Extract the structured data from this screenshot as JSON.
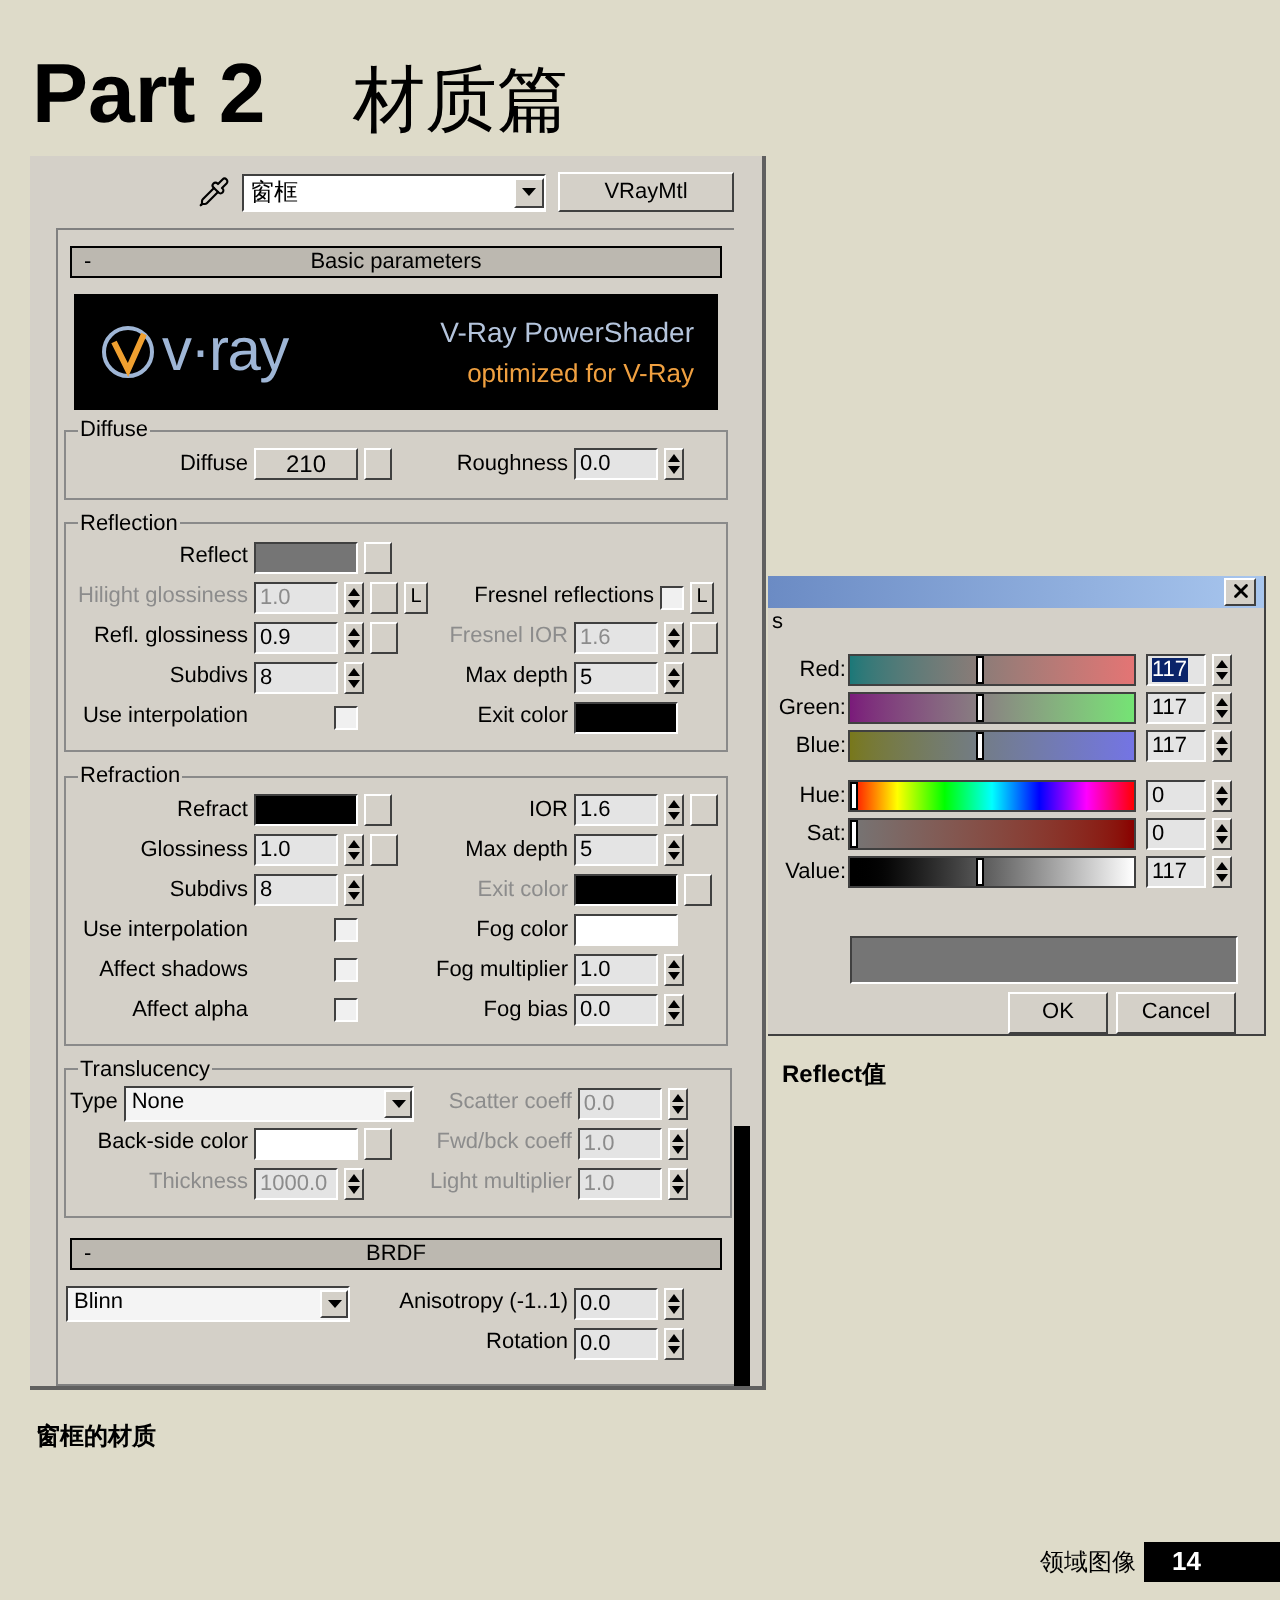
{
  "heading": {
    "part": "Part 2",
    "title": "材质篇"
  },
  "material_editor": {
    "material_name": "窗框",
    "type_button": "VRayMtl",
    "rollouts": [
      {
        "toggle": "-",
        "title": "Basic parameters",
        "banner": {
          "logo": "v·ray",
          "title": "V-Ray PowerShader",
          "subtitle": "optimized for V-Ray"
        },
        "groups": [
          {
            "title": "Diffuse",
            "rows": [
              {
                "left": {
                  "kind": "color",
                  "label": "Diffuse",
                  "color": "#d4d0c8",
                  "swatch_text": "210",
                  "map": true
                },
                "right": {
                  "kind": "spinner",
                  "label": "Roughness",
                  "value": "0.0",
                  "disabled": false
                }
              }
            ]
          },
          {
            "title": "Reflection",
            "rows": [
              {
                "left": {
                  "kind": "color",
                  "label": "Reflect",
                  "color": "#757575",
                  "map": true
                }
              },
              {
                "left": {
                  "kind": "spinner",
                  "label": "Hilight glossiness",
                  "value": "1.0",
                  "disabled": true,
                  "map": true,
                  "lock": "L"
                },
                "right": {
                  "kind": "checkbox",
                  "label": "Fresnel reflections",
                  "checked": false,
                  "lock": "L"
                }
              },
              {
                "left": {
                  "kind": "spinner",
                  "label": "Refl. glossiness",
                  "value": "0.9",
                  "disabled": false,
                  "map": true
                },
                "right": {
                  "kind": "spinner",
                  "label": "Fresnel IOR",
                  "value": "1.6",
                  "disabled": true,
                  "map": true
                }
              },
              {
                "left": {
                  "kind": "spinner",
                  "label": "Subdivs",
                  "value": "8",
                  "disabled": false
                },
                "right": {
                  "kind": "spinner",
                  "label": "Max depth",
                  "value": "5",
                  "disabled": false
                }
              },
              {
                "left": {
                  "kind": "checkbox",
                  "label": "Use interpolation",
                  "checked": false
                },
                "right": {
                  "kind": "color",
                  "label": "Exit color",
                  "color": "#000000"
                }
              }
            ]
          },
          {
            "title": "Refraction",
            "rows": [
              {
                "left": {
                  "kind": "color",
                  "label": "Refract",
                  "color": "#000000",
                  "map": true
                },
                "right": {
                  "kind": "spinner",
                  "label": "IOR",
                  "value": "1.6",
                  "disabled": false,
                  "map": true
                }
              },
              {
                "left": {
                  "kind": "spinner",
                  "label": "Glossiness",
                  "value": "1.0",
                  "disabled": false,
                  "map": true
                },
                "right": {
                  "kind": "spinner",
                  "label": "Max depth",
                  "value": "5",
                  "disabled": false
                }
              },
              {
                "left": {
                  "kind": "spinner",
                  "label": "Subdivs",
                  "value": "8",
                  "disabled": false
                },
                "right": {
                  "kind": "color",
                  "label": "Exit color",
                  "color": "#000000",
                  "disabled": true,
                  "map": true
                }
              },
              {
                "left": {
                  "kind": "checkbox",
                  "label": "Use interpolation",
                  "checked": false
                },
                "right": {
                  "kind": "color",
                  "label": "Fog color",
                  "color": "#ffffff"
                }
              },
              {
                "left": {
                  "kind": "checkbox",
                  "label": "Affect shadows",
                  "checked": false
                },
                "right": {
                  "kind": "spinner",
                  "label": "Fog multiplier",
                  "value": "1.0",
                  "disabled": false
                }
              },
              {
                "left": {
                  "kind": "checkbox",
                  "label": "Affect alpha",
                  "checked": false
                },
                "right": {
                  "kind": "spinner",
                  "label": "Fog bias",
                  "value": "0.0",
                  "disabled": false
                }
              }
            ]
          },
          {
            "title": "Translucency",
            "rows": [
              {
                "left": {
                  "kind": "dropdown",
                  "label": "Type",
                  "value": "None"
                },
                "right": {
                  "kind": "spinner",
                  "label": "Scatter coeff",
                  "value": "0.0",
                  "disabled": true
                }
              },
              {
                "left": {
                  "kind": "color",
                  "label": "Back-side color",
                  "color": "#ffffff",
                  "map": true
                },
                "right": {
                  "kind": "spinner",
                  "label": "Fwd/bck coeff",
                  "value": "1.0",
                  "disabled": true
                }
              },
              {
                "left": {
                  "kind": "spinner",
                  "label": "Thickness",
                  "value": "1000.0",
                  "disabled": true
                },
                "right": {
                  "kind": "spinner",
                  "label": "Light multiplier",
                  "value": "1.0",
                  "disabled": true
                }
              }
            ]
          }
        ]
      },
      {
        "toggle": "-",
        "title": "BRDF",
        "rows": [
          {
            "left": {
              "kind": "dropdown",
              "value": "Blinn"
            },
            "right": {
              "kind": "spinner",
              "label": "Anisotropy (-1..1)",
              "value": "0.0",
              "disabled": false
            }
          },
          {
            "right": {
              "kind": "spinner",
              "label": "Rotation",
              "value": "0.0",
              "disabled": false
            }
          }
        ]
      }
    ]
  },
  "color_picker": {
    "partial_label": "s",
    "channels": [
      {
        "label": "Red:",
        "kind": "red",
        "level": 0.459,
        "value": "117",
        "selected": true
      },
      {
        "label": "Green:",
        "kind": "green",
        "level": 0.459,
        "value": "117",
        "selected": false
      },
      {
        "label": "Blue:",
        "kind": "blue",
        "level": 0.459,
        "value": "117",
        "selected": false
      },
      {
        "label": "Hue:",
        "kind": "hue",
        "level": 0,
        "value": "0",
        "selected": false
      },
      {
        "label": "Sat:",
        "kind": "sat",
        "level": 0,
        "value": "0",
        "selected": false
      },
      {
        "label": "Value:",
        "kind": "value",
        "level": 0.459,
        "value": "117",
        "selected": false
      }
    ],
    "preview": {
      "color": "#757575"
    },
    "buttons": [
      "OK",
      "Cancel"
    ]
  },
  "picker_caption": "Reflect值",
  "editor_caption": "窗框的材质",
  "footer": {
    "publisher": "领域图像",
    "page": "14"
  }
}
